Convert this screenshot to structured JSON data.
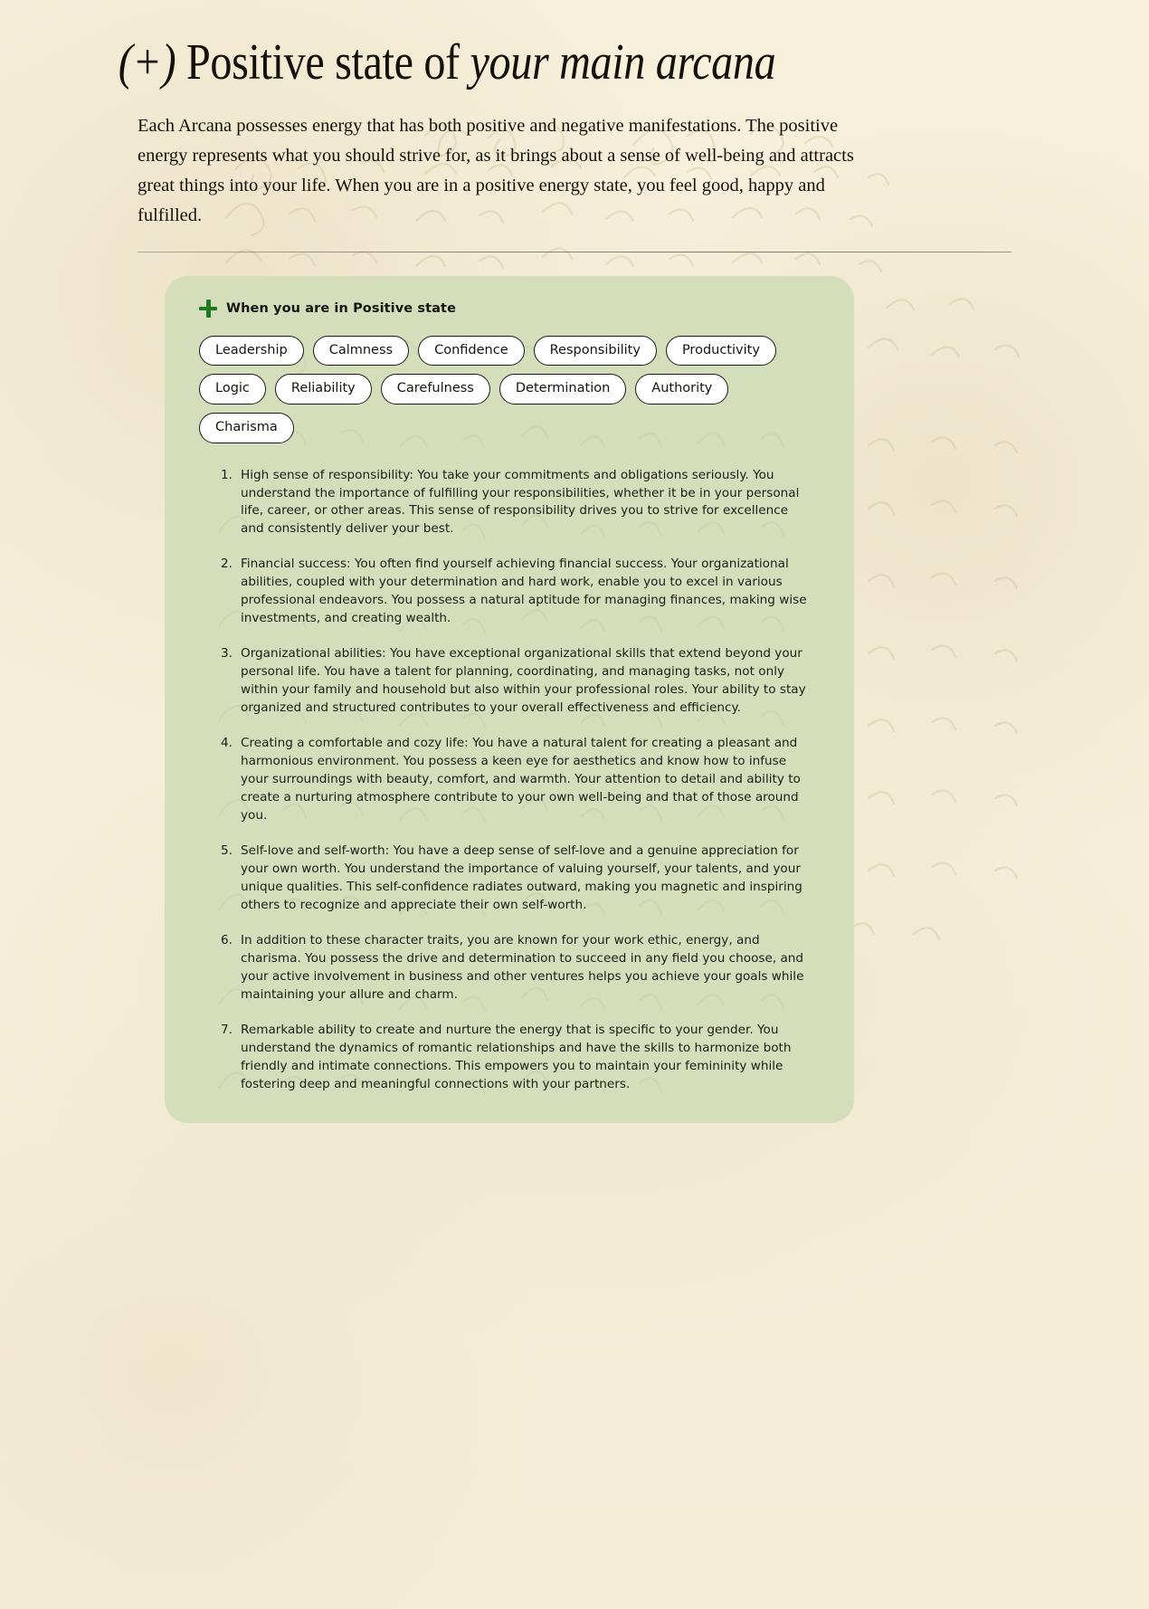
{
  "theme": {
    "paper_bg": "#f6efda",
    "card_bg": "#d4debb",
    "plus_icon_color": "#1e7a21",
    "text_color": "#15150f",
    "pill_bg": "#ffffff",
    "pill_border": "#1a1a14"
  },
  "header": {
    "title_prefix": "(+)",
    "title_main": "Positive state of ",
    "title_emphasis": "your main arcana"
  },
  "intro": {
    "paragraph": "Each Arcana possesses energy that has both positive and negative manifestations. The positive energy represents what you should strive for, as it brings about a sense of well-being and attracts great things into your life. When you are in a positive energy state, you feel good, happy and fulfilled."
  },
  "card": {
    "icon": "plus-icon",
    "header_label": "When you are in Positive state",
    "tags": [
      "Leadership",
      "Calmness",
      "Confidence",
      "Responsibility",
      "Productivity",
      "Logic",
      "Reliability",
      "Carefulness",
      "Determination",
      "Authority",
      "Charisma"
    ],
    "traits": [
      "High sense of responsibility: You take your commitments and obligations seriously. You understand the importance of fulfilling your responsibilities, whether it be in your personal life, career, or other areas. This sense of responsibility drives you to strive for excellence and consistently deliver your best.",
      "Financial success: You often find yourself achieving financial success. Your organizational abilities, coupled with your determination and hard work, enable you to excel in various professional endeavors. You possess a natural aptitude for managing finances, making wise investments, and creating wealth.",
      "Organizational abilities: You have exceptional organizational skills that extend beyond your personal life. You have a talent for planning, coordinating, and managing tasks, not only within your family and household but also within your professional roles. Your ability to stay organized and structured contributes to your overall effectiveness and efficiency.",
      "Creating a comfortable and cozy life: You have a natural talent for creating a pleasant and harmonious environment. You possess a keen eye for aesthetics and know how to infuse your surroundings with beauty, comfort, and warmth. Your attention to detail and ability to create a nurturing atmosphere contribute to your own well-being and that of those around you.",
      "Self-love and self-worth: You have a deep sense of self-love and a genuine appreciation for your own worth. You understand the importance of valuing yourself, your talents, and your unique qualities. This self-confidence radiates outward, making you magnetic and inspiring others to recognize and appreciate their own self-worth.",
      "In addition to these character traits, you are known for your work ethic, energy, and charisma. You possess the drive and determination to succeed in any field you choose, and your active involvement in business and other ventures helps you achieve your goals while maintaining your allure and charm.",
      "Remarkable ability to create and nurture the energy that is specific to your gender. You understand the dynamics of romantic relationships and have the skills to harmonize both friendly and intimate connections. This empowers you to maintain your femininity while fostering deep and meaningful connections with your partners."
    ]
  }
}
